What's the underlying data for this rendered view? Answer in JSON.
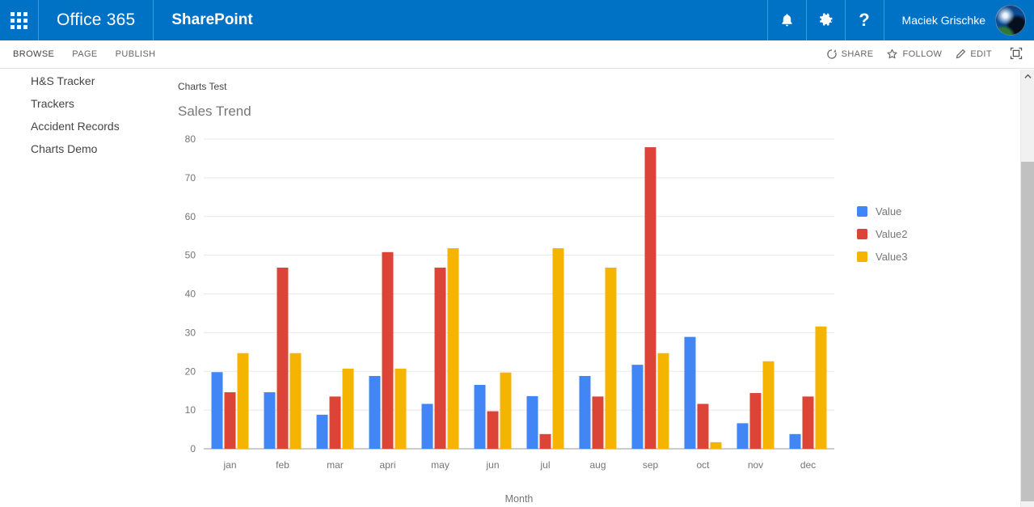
{
  "suite_bar": {
    "waffle_icon": "app-launcher-icon",
    "brand": "Office 365",
    "app": "SharePoint",
    "notifications_icon": "bell-icon",
    "settings_icon": "gear-icon",
    "help_icon": "question-mark-icon",
    "user_name": "Maciek Grischke",
    "avatar_icon": "user-avatar",
    "background_color": "#0072c6"
  },
  "ribbon": {
    "tabs": [
      {
        "label": "BROWSE"
      },
      {
        "label": "PAGE"
      },
      {
        "label": "PUBLISH"
      }
    ],
    "actions": [
      {
        "label": "SHARE",
        "icon": "share-icon"
      },
      {
        "label": "FOLLOW",
        "icon": "star-icon"
      },
      {
        "label": "EDIT",
        "icon": "pencil-icon"
      }
    ],
    "focus_label": "",
    "focus_icon": "focus-on-content-icon"
  },
  "left_nav": {
    "items": [
      {
        "label": "H&S Tracker"
      },
      {
        "label": "Trackers"
      },
      {
        "label": "Accident Records"
      },
      {
        "label": "Charts Demo"
      }
    ]
  },
  "content": {
    "breadcrumb": "Charts Test",
    "chart_heading": "Sales Trend"
  },
  "scrollbar": {
    "up_arrow_icon": "chevron-up-icon"
  },
  "chart_data": {
    "type": "bar",
    "title": "Sales Trend",
    "xlabel": "Month",
    "ylabel": "",
    "ylim": [
      0,
      80
    ],
    "yticks": [
      0,
      10,
      20,
      30,
      40,
      50,
      60,
      70,
      80
    ],
    "grid": true,
    "legend_position": "right",
    "categories": [
      "jan",
      "feb",
      "mar",
      "apri",
      "may",
      "jun",
      "jul",
      "aug",
      "sep",
      "oct",
      "nov",
      "dec"
    ],
    "series": [
      {
        "name": "Value",
        "color": "#4285f4",
        "values": [
          19.8,
          14.6,
          8.8,
          18.8,
          11.6,
          16.5,
          13.6,
          18.8,
          21.7,
          28.9,
          6.6,
          3.8
        ]
      },
      {
        "name": "Value2",
        "color": "#db4437",
        "values": [
          14.6,
          46.8,
          13.5,
          50.8,
          46.8,
          9.7,
          3.8,
          13.5,
          77.9,
          11.6,
          14.4,
          13.5
        ]
      },
      {
        "name": "Value3",
        "color": "#f4b400",
        "values": [
          24.7,
          24.7,
          20.7,
          20.7,
          51.8,
          19.7,
          51.8,
          46.8,
          24.7,
          1.7,
          22.6,
          31.6
        ]
      }
    ]
  }
}
